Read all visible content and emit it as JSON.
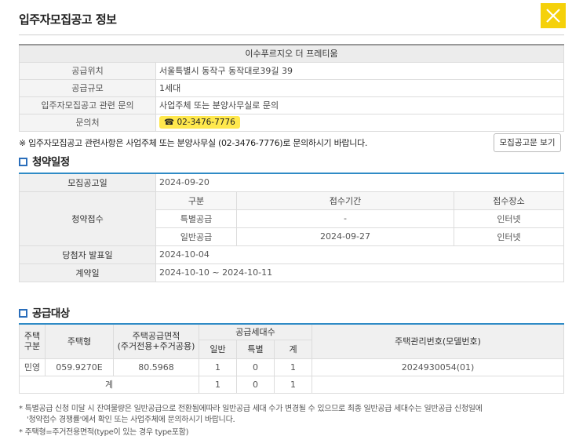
{
  "header": {
    "title": "입주자모집공고 정보"
  },
  "info": {
    "complex_name": "이수푸르지오 더 프레티움",
    "rows": [
      {
        "label": "공급위치",
        "value": "서울특별시 동작구 동작대로39길 39"
      },
      {
        "label": "공급규모",
        "value": "1세대"
      },
      {
        "label": "입주자모집공고 관련 문의",
        "value": "사업주체 또는 분양사무실로 문의"
      }
    ],
    "contact_label": "문의처",
    "contact_icon": "☎",
    "contact_phone": "02-3476-7776"
  },
  "notice": {
    "text": "※ 입주자모집공고 관련사항은 사업주체 또는 분양사무실 (02-3476-7776)로 문의하시기 바랍니다.",
    "button_label": "모집공고문 보기"
  },
  "schedule": {
    "section_title": "청약일정",
    "announce_label": "모집공고일",
    "announce_date": "2024-09-20",
    "apply_label": "청약접수",
    "headers": [
      "구분",
      "접수기간",
      "접수장소"
    ],
    "rows": [
      {
        "type": "특별공급",
        "period": "-",
        "place": "인터넷"
      },
      {
        "type": "일반공급",
        "period": "2024-09-27",
        "place": "인터넷"
      }
    ],
    "winner_label": "당첨자 발표일",
    "winner_date": "2024-10-04",
    "contract_label": "계약일",
    "contract_date": "2024-10-10 ~ 2024-10-11"
  },
  "supply": {
    "section_title": "공급대상",
    "headers": {
      "house_type_div": "주택\n구분",
      "house_type": "주택형",
      "area": "주택공급면적\n(주거전용+주거공용)",
      "units": "공급세대수",
      "general": "일반",
      "special": "특별",
      "total": "계",
      "model_no": "주택관리번호(모델번호)"
    },
    "rows": [
      {
        "div": "민영",
        "type": "059.9270E",
        "area": "80.5968",
        "general": "1",
        "special": "0",
        "total": "1",
        "model_no": "2024930054(01)"
      }
    ],
    "sum": {
      "label": "계",
      "general": "1",
      "special": "0",
      "total": "1"
    }
  },
  "footnotes": {
    "line1": "* 특별공급 신청 미달 시 잔여물량은 일반공급으로 전환됨에따라 일반공급 세대 수가 변경될 수 있으므로 최종 일반공급 세대수는 일반공급 신청일에",
    "line2": "'청약접수 경쟁률'에서 확인 또는 사업주체에 문의하시기 바랍니다.",
    "line3": "* 주택형=주거전용면적(type이 있는 경우 type포함)"
  },
  "colors": {
    "accent_yellow": "#f5d10a",
    "accent_blue": "#2f8bc6"
  }
}
